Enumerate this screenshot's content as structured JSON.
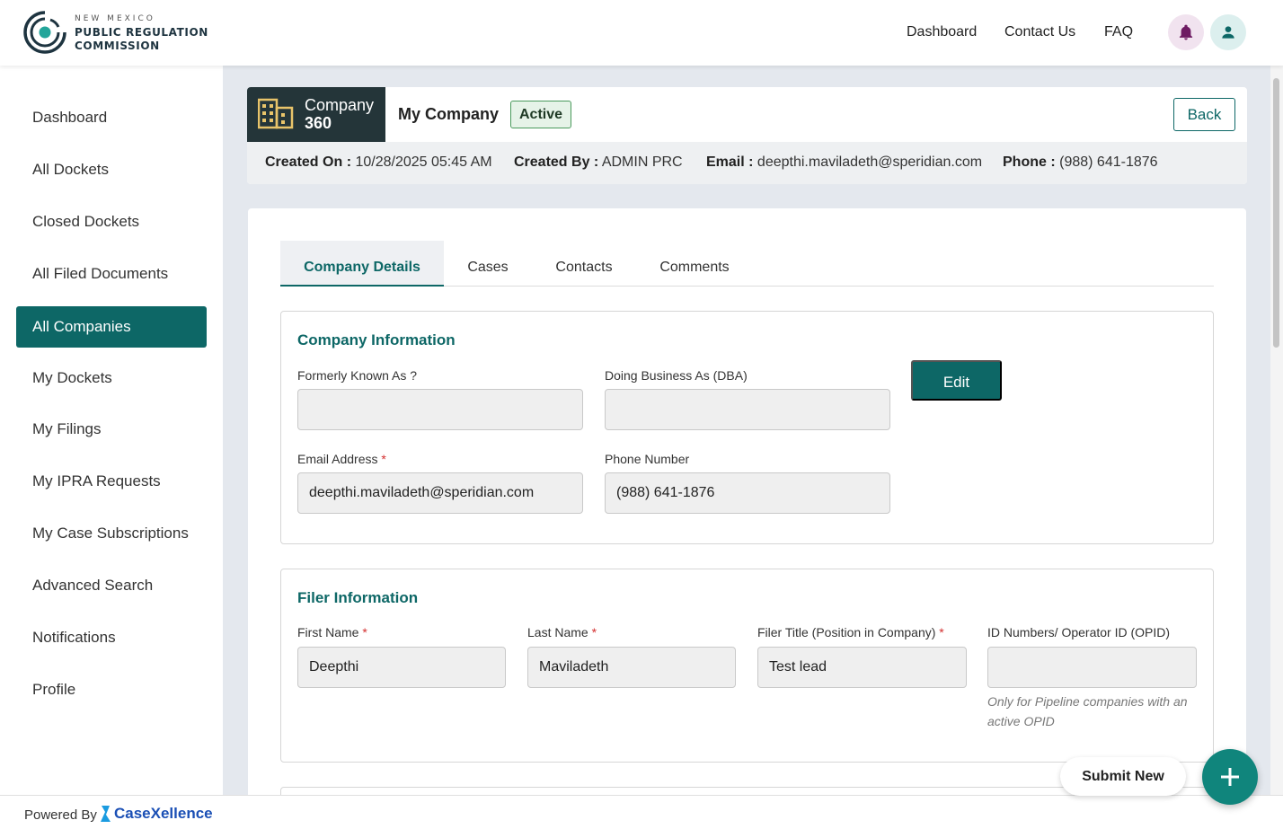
{
  "header": {
    "logo": {
      "line1": "NEW MEXICO",
      "line2": "PUBLIC REGULATION",
      "line3": "COMMISSION"
    },
    "nav": [
      "Dashboard",
      "Contact Us",
      "FAQ"
    ],
    "colors": {
      "brand": "#0d6766",
      "bell": "#6e1c63",
      "user": "#0d6766"
    }
  },
  "sidebar": {
    "items": [
      {
        "label": "Dashboard"
      },
      {
        "label": "All Dockets"
      },
      {
        "label": "Closed Dockets"
      },
      {
        "label": "All Filed Documents"
      },
      {
        "label": "All Companies",
        "active": true
      },
      {
        "label": "My Dockets"
      },
      {
        "label": "My Filings"
      },
      {
        "label": "My IPRA Requests"
      },
      {
        "label": "My Case Subscriptions"
      },
      {
        "label": "Advanced Search"
      },
      {
        "label": "Notifications"
      },
      {
        "label": "Profile"
      }
    ]
  },
  "company_header": {
    "badge_line1": "Company",
    "badge_line2": "360",
    "name": "My Company",
    "status": "Active",
    "back_label": "Back",
    "meta": {
      "created_on_label": "Created On :",
      "created_on": "10/28/2025 05:45 AM",
      "created_by_label": "Created By :",
      "created_by": "ADMIN PRC",
      "email_label": "Email :",
      "email": "deepthi.maviladeth@speridian.com",
      "phone_label": "Phone :",
      "phone": "(988) 641-1876"
    }
  },
  "tabs": [
    {
      "label": "Company Details",
      "active": true
    },
    {
      "label": "Cases"
    },
    {
      "label": "Contacts"
    },
    {
      "label": "Comments"
    }
  ],
  "company_info": {
    "title": "Company Information",
    "edit_label": "Edit",
    "fields": {
      "fka": {
        "label": "Formerly Known As ?",
        "value": ""
      },
      "dba": {
        "label": "Doing Business As (DBA)",
        "value": ""
      },
      "email": {
        "label": "Email Address",
        "required": "*",
        "value": "deepthi.maviladeth@speridian.com"
      },
      "phone": {
        "label": "Phone Number",
        "value": "(988) 641-1876"
      }
    }
  },
  "filer_info": {
    "title": "Filer Information",
    "fields": {
      "first_name": {
        "label": "First Name",
        "required": "*",
        "value": "Deepthi"
      },
      "last_name": {
        "label": "Last Name",
        "required": "*",
        "value": "Maviladeth"
      },
      "title": {
        "label": "Filer Title (Position in Company)",
        "required": "*",
        "value": "Test lead"
      },
      "opid": {
        "label": "ID Numbers/ Operator ID (OPID)",
        "value": "",
        "helper": "Only for Pipeline companies with an active OPID"
      }
    }
  },
  "footer": {
    "powered_by": "Powered By",
    "brand": "CaseXellence"
  },
  "actions": {
    "submit_new": "Submit New"
  }
}
